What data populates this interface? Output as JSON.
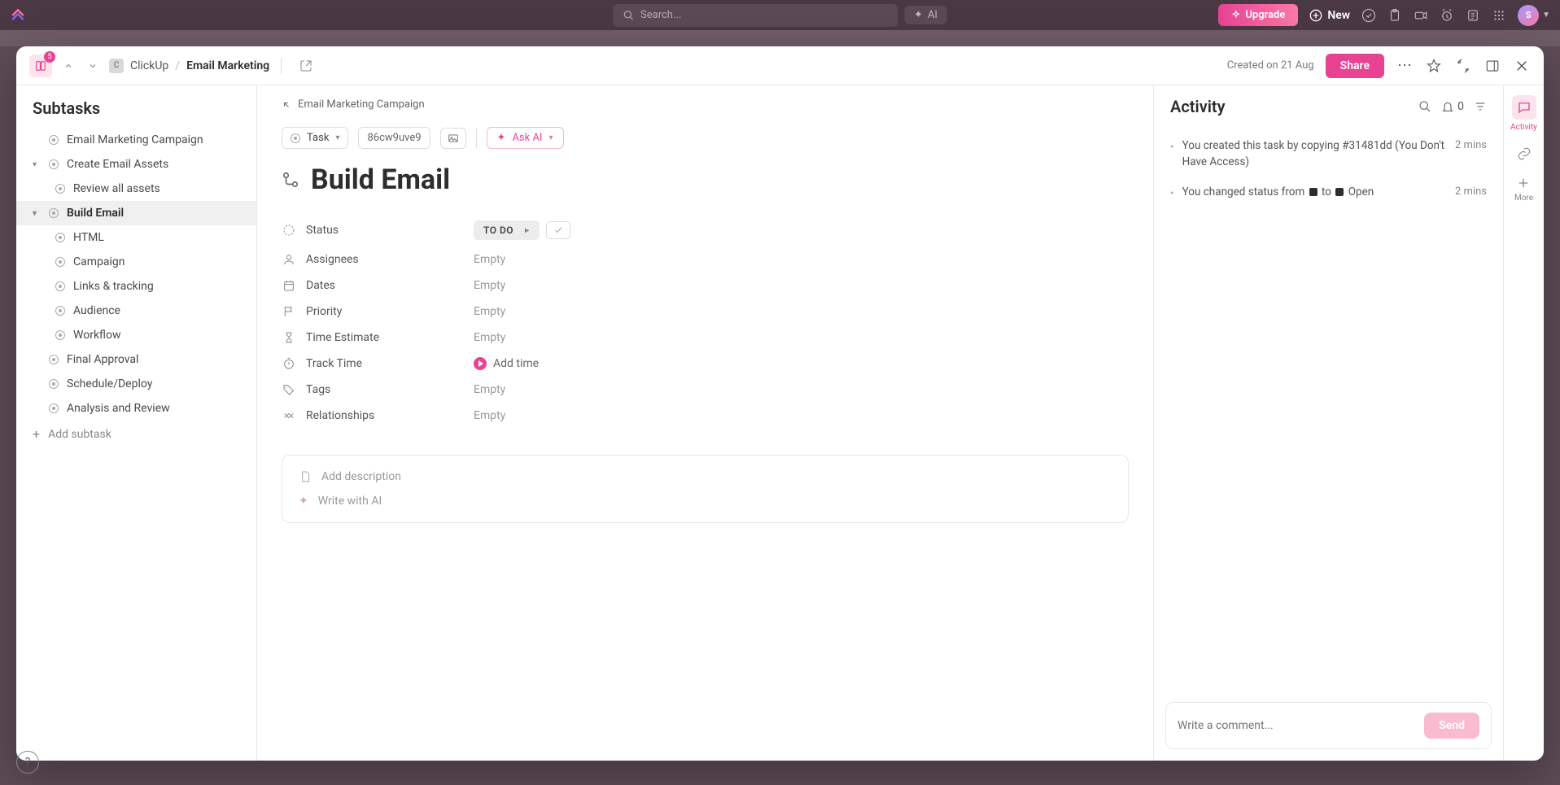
{
  "topbar": {
    "search_placeholder": "Search...",
    "ai_label": "AI",
    "upgrade": "Upgrade",
    "new": "New",
    "avatar_initial": "S"
  },
  "header": {
    "badge_count": "5",
    "workspace_letter": "C",
    "workspace_name": "ClickUp",
    "breadcrumb_current": "Email Marketing",
    "created_on": "Created on 21 Aug",
    "share": "Share"
  },
  "sidebar": {
    "title": "Subtasks",
    "items": [
      {
        "label": "Email Marketing Campaign",
        "level": 0,
        "expandable": false
      },
      {
        "label": "Create Email Assets",
        "level": 0,
        "expandable": true
      },
      {
        "label": "Review all assets",
        "level": 1
      },
      {
        "label": "Build Email",
        "level": 0,
        "expandable": true,
        "active": true
      },
      {
        "label": "HTML",
        "level": 1
      },
      {
        "label": "Campaign",
        "level": 1
      },
      {
        "label": "Links & tracking",
        "level": 1
      },
      {
        "label": "Audience",
        "level": 1
      },
      {
        "label": "Workflow",
        "level": 1
      },
      {
        "label": "Final Approval",
        "level": 0
      },
      {
        "label": "Schedule/Deploy",
        "level": 0
      },
      {
        "label": "Analysis and Review",
        "level": 0
      }
    ],
    "add_subtask": "Add subtask"
  },
  "main": {
    "parent_link": "Email Marketing Campaign",
    "task_type": "Task",
    "task_id": "86cw9uve9",
    "ask_ai": "Ask AI",
    "title": "Build Email",
    "fields": {
      "status_label": "Status",
      "status_value": "TO DO",
      "assignees_label": "Assignees",
      "assignees_value": "Empty",
      "dates_label": "Dates",
      "dates_value": "Empty",
      "priority_label": "Priority",
      "priority_value": "Empty",
      "time_estimate_label": "Time Estimate",
      "time_estimate_value": "Empty",
      "track_time_label": "Track Time",
      "track_time_value": "Add time",
      "tags_label": "Tags",
      "tags_value": "Empty",
      "relationships_label": "Relationships",
      "relationships_value": "Empty"
    },
    "add_description": "Add description",
    "write_with_ai": "Write with AI"
  },
  "activity": {
    "title": "Activity",
    "notif_count": "0",
    "items": [
      {
        "text_pre": "You created this task by copying #31481dd (You Don't Have Access)",
        "time": "2 mins"
      },
      {
        "text_pre": "You changed status from ",
        "text_mid": " to ",
        "text_post": " Open",
        "time": "2 mins",
        "has_boxes": true
      }
    ],
    "comment_placeholder": "Write a comment...",
    "send": "Send"
  },
  "rail": {
    "activity": "Activity",
    "more": "More"
  }
}
